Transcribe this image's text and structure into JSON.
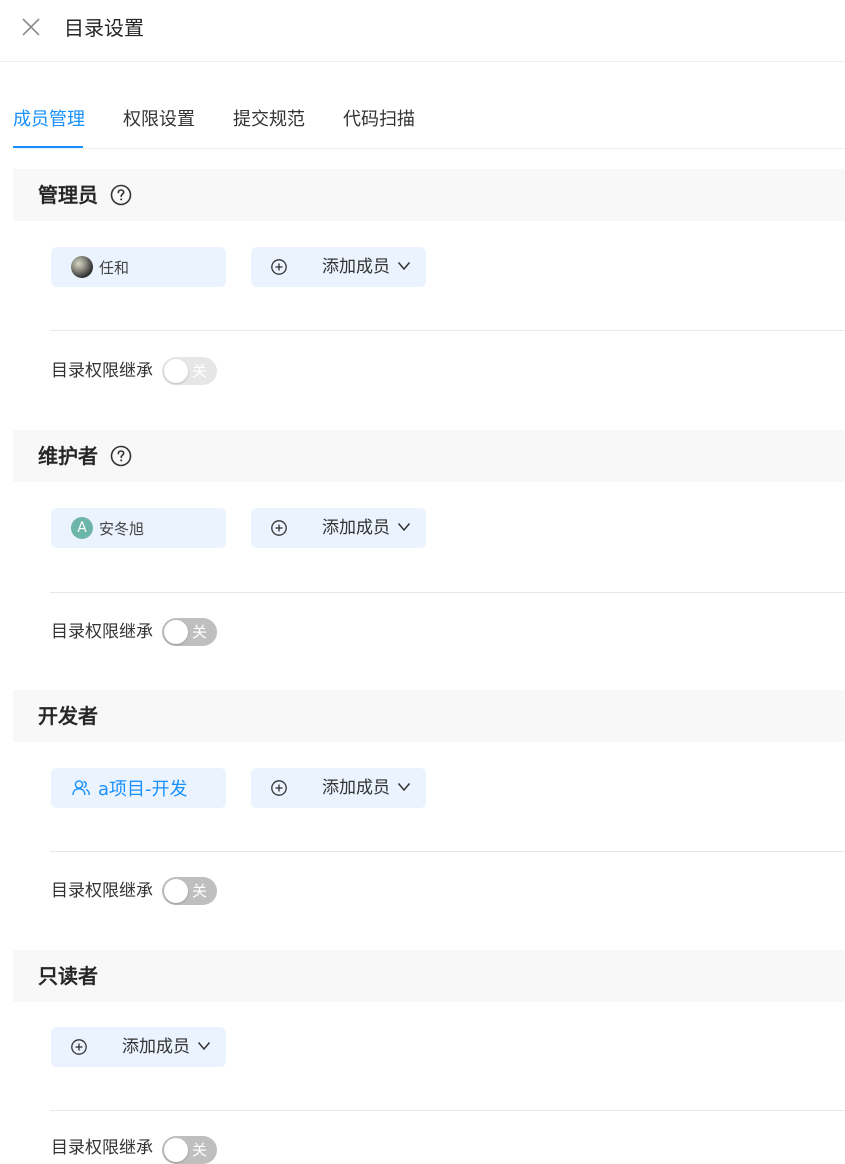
{
  "header": {
    "title": "目录设置"
  },
  "tabs": [
    {
      "label": "成员管理",
      "active": true
    },
    {
      "label": "权限设置",
      "active": false
    },
    {
      "label": "提交规范",
      "active": false
    },
    {
      "label": "代码扫描",
      "active": false
    }
  ],
  "sections": [
    {
      "title": "管理员",
      "has_help": true,
      "member": {
        "name": "任和",
        "type": "user-photo"
      },
      "add_label": "添加成员",
      "inherit_label": "目录权限继承",
      "toggle_text": "关",
      "toggle_on": false
    },
    {
      "title": "维护者",
      "has_help": true,
      "member": {
        "name": "安冬旭",
        "type": "user-letter",
        "letter": "A"
      },
      "add_label": "添加成员",
      "inherit_label": "目录权限继承",
      "toggle_text": "关",
      "toggle_on": false
    },
    {
      "title": "开发者",
      "has_help": false,
      "member": {
        "name": "a项目-开发",
        "type": "group"
      },
      "add_label": "添加成员",
      "inherit_label": "目录权限继承",
      "toggle_text": "关",
      "toggle_on": false
    },
    {
      "title": "只读者",
      "has_help": false,
      "add_label": "添加成员",
      "inherit_label": "目录权限继承",
      "toggle_text": "关",
      "toggle_on": false
    }
  ],
  "colors": {
    "accent": "#1890ff",
    "chip_bg": "#eaf3fe",
    "section_bg": "#f8f8f8",
    "toggle_off": "#bfbfbf",
    "avatar_letter_bg": "#6cb5a9"
  },
  "icons": {
    "close": "close-icon",
    "help": "question-circle-icon",
    "add": "plus-circle-icon",
    "dropdown": "chevron-down-icon",
    "group": "user-group-icon"
  }
}
